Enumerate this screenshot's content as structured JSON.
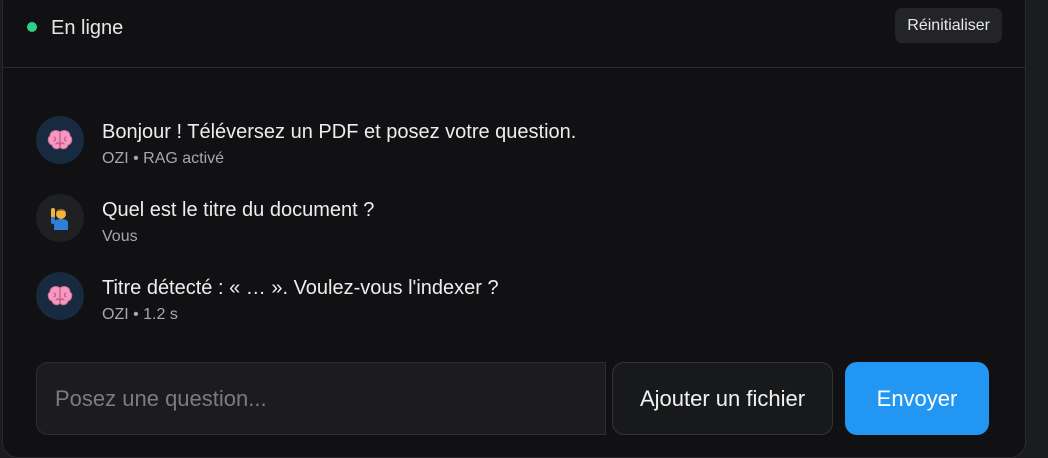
{
  "header": {
    "status_text": "En ligne",
    "status_color": "#2fd08a",
    "reset_label": "Réinitialiser"
  },
  "messages": [
    {
      "role": "bot",
      "avatar_icon": "brain-icon",
      "text": "Bonjour ! Téléversez un PDF et posez votre question.",
      "meta": "OZI • RAG activé"
    },
    {
      "role": "user",
      "avatar_icon": "person-raising-hand-icon",
      "text": "Quel est le titre du document ?",
      "meta": "Vous"
    },
    {
      "role": "bot",
      "avatar_icon": "brain-icon",
      "text": "Titre détecté : « … ». Voulez-vous l'indexer ?",
      "meta": "OZI • 1.2 s"
    }
  ],
  "composer": {
    "placeholder": "Posez une question...",
    "value": "",
    "upload_label": "Ajouter un fichier",
    "send_label": "Envoyer",
    "accent_color": "#2196f3"
  }
}
